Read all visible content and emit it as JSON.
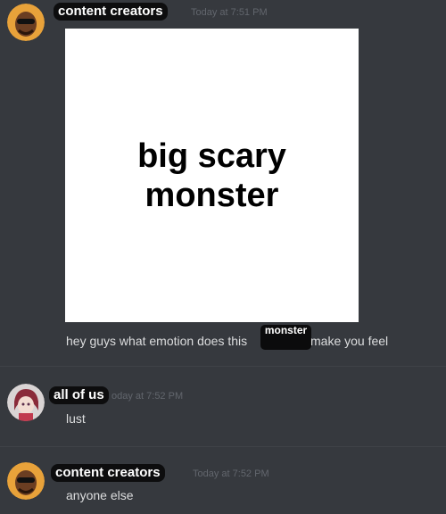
{
  "messages": [
    {
      "username": "content creators",
      "timestamp": "Today at 7:51 PM",
      "image_text_line1": "big scary",
      "image_text_line2": "monster",
      "text_before": "hey guys what emotion does this",
      "censor_label": "monster",
      "text_after": "make you feel"
    },
    {
      "username": "all of us",
      "timestamp": "oday at 7:52 PM",
      "text": "lust"
    },
    {
      "username": "content creators",
      "timestamp": "Today at 7:52 PM",
      "text": "anyone else"
    }
  ],
  "colors": {
    "background": "#36393e",
    "message_text": "#dcddde",
    "timestamp": "#62666d",
    "username_highlight": "#0d0d0e"
  },
  "icons": [
    "avatar-bald-man",
    "avatar-anime-girl"
  ]
}
